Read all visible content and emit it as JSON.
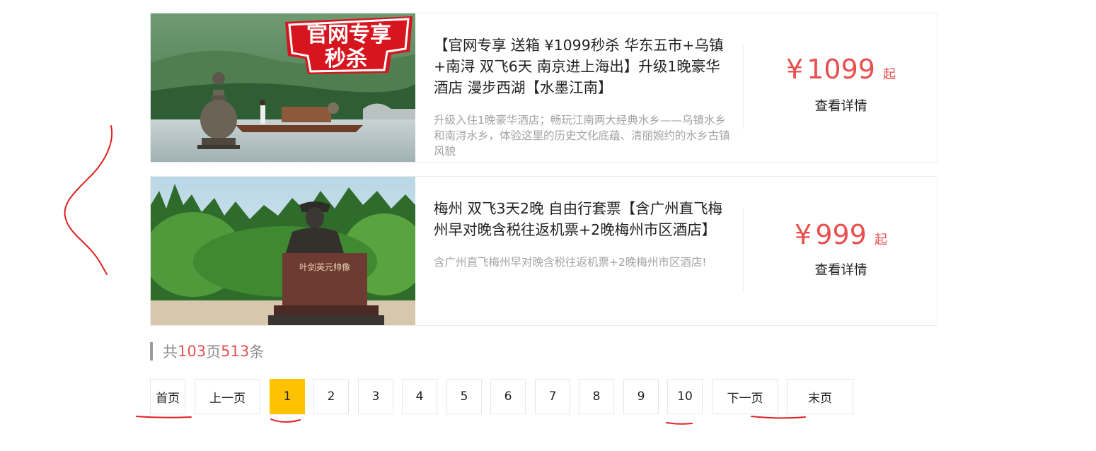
{
  "products": [
    {
      "badge": "官网专享 秒杀",
      "title": "【官网专享 送箱 ¥1099秒杀 华东五市+乌镇+南浔 双飞6天 南京进上海出】升级1晚豪华酒店 漫步西湖【水墨江南】",
      "desc": "升级入住1晚豪华酒店；畅玩江南两大经典水乡——乌镇水乡和南浔水乡，体验这里的历史文化底蕴、清丽婉约的水乡古镇风貌",
      "currency": "¥",
      "price": "1099",
      "price_suffix": "起",
      "detail_label": "查看详情",
      "image": "west-lake-pagoda-photo"
    },
    {
      "title": "梅州 双飞3天2晚 自由行套票【含广州直飞梅州早对晚含税往返机票+2晚梅州市区酒店】",
      "desc": "含广州直飞梅州早对晚含税往返机票+2晚梅州市区酒店!",
      "currency": "¥",
      "price": "999",
      "price_suffix": "起",
      "detail_label": "查看详情",
      "image": "statue-memorial-photo",
      "statue_inscription": "叶剑英元帅像"
    }
  ],
  "summary": {
    "prefix": "共 ",
    "pages": "103",
    "page_unit": "页",
    "records": "513",
    "record_unit": "条"
  },
  "pagination": {
    "first": "首页",
    "prev": "上一页",
    "pages": [
      "1",
      "2",
      "3",
      "4",
      "5",
      "6",
      "7",
      "8",
      "9",
      "10"
    ],
    "current": "1",
    "next": "下一页",
    "last": "末页"
  },
  "colors": {
    "price": "#e94f4f",
    "active_page": "#ffc200",
    "annotation": "#e02020"
  }
}
